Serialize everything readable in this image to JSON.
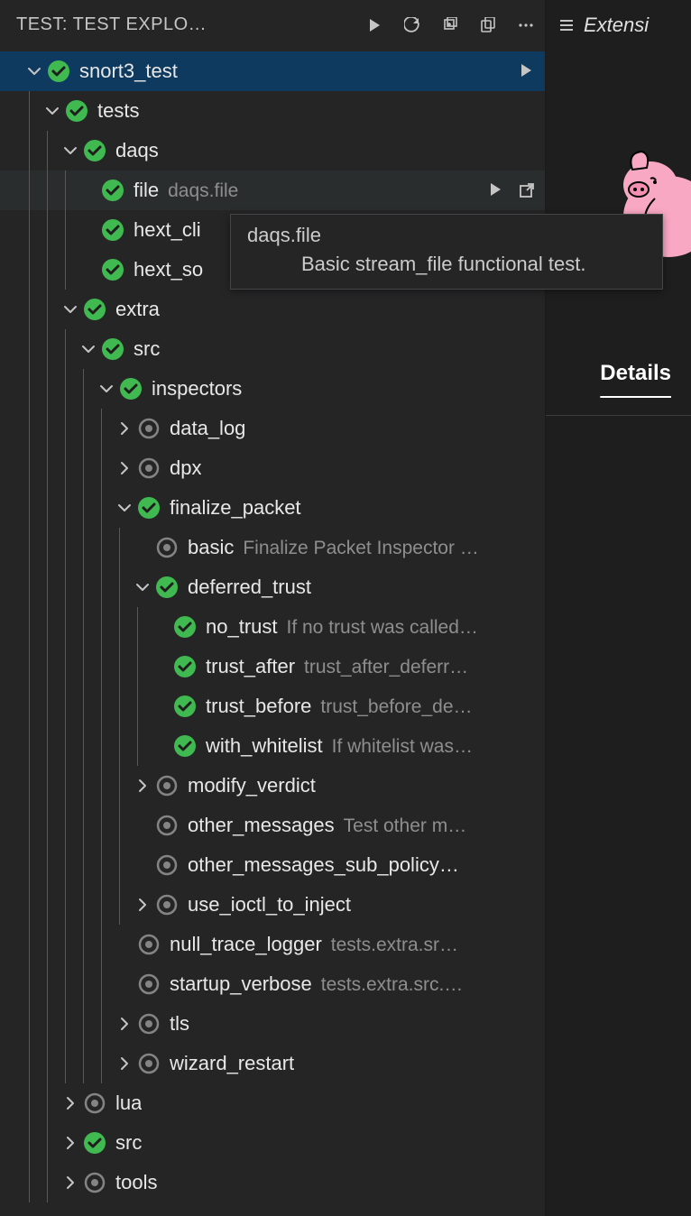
{
  "tabTitle": "TEST: TEST EXPLO…",
  "extTab": "Extensi",
  "detailsTab": "Details",
  "tooltip": {
    "title": "daqs.file",
    "body": "Basic stream_file functional test."
  },
  "tree": [
    {
      "depth": 0,
      "chev": "down",
      "status": "pass",
      "label": "snort3_test",
      "selected": true,
      "actions": [
        "play"
      ]
    },
    {
      "depth": 1,
      "chev": "down",
      "status": "pass",
      "label": "tests"
    },
    {
      "depth": 2,
      "chev": "down",
      "status": "pass",
      "label": "daqs"
    },
    {
      "depth": 3,
      "chev": "none",
      "status": "pass",
      "label": "file",
      "desc": "daqs.file",
      "hovered": true,
      "actions": [
        "play",
        "go"
      ]
    },
    {
      "depth": 3,
      "chev": "none",
      "status": "pass",
      "label": "hext_cli"
    },
    {
      "depth": 3,
      "chev": "none",
      "status": "pass",
      "label": "hext_so"
    },
    {
      "depth": 2,
      "chev": "down",
      "status": "pass",
      "label": "extra"
    },
    {
      "depth": 3,
      "chev": "down",
      "status": "pass",
      "label": "src"
    },
    {
      "depth": 4,
      "chev": "down",
      "status": "pass",
      "label": "inspectors"
    },
    {
      "depth": 5,
      "chev": "right",
      "status": "notrun",
      "label": "data_log"
    },
    {
      "depth": 5,
      "chev": "right",
      "status": "notrun",
      "label": "dpx"
    },
    {
      "depth": 5,
      "chev": "down",
      "status": "pass",
      "label": "finalize_packet"
    },
    {
      "depth": 6,
      "chev": "none",
      "status": "notrun",
      "label": "basic",
      "desc": "Finalize Packet Inspector …"
    },
    {
      "depth": 6,
      "chev": "down",
      "status": "pass",
      "label": "deferred_trust"
    },
    {
      "depth": 7,
      "chev": "none",
      "status": "pass",
      "label": "no_trust",
      "desc": "If no trust was called…"
    },
    {
      "depth": 7,
      "chev": "none",
      "status": "pass",
      "label": "trust_after",
      "desc": "trust_after_deferr…"
    },
    {
      "depth": 7,
      "chev": "none",
      "status": "pass",
      "label": "trust_before",
      "desc": "trust_before_de…"
    },
    {
      "depth": 7,
      "chev": "none",
      "status": "pass",
      "label": "with_whitelist",
      "desc": "If whitelist was…"
    },
    {
      "depth": 6,
      "chev": "right",
      "status": "notrun",
      "label": "modify_verdict"
    },
    {
      "depth": 6,
      "chev": "none",
      "status": "notrun",
      "label": "other_messages",
      "desc": "Test other m…"
    },
    {
      "depth": 6,
      "chev": "none",
      "status": "notrun",
      "label": "other_messages_sub_policy…"
    },
    {
      "depth": 6,
      "chev": "right",
      "status": "notrun",
      "label": "use_ioctl_to_inject"
    },
    {
      "depth": 5,
      "chev": "none",
      "status": "notrun",
      "label": "null_trace_logger",
      "desc": "tests.extra.sr…"
    },
    {
      "depth": 5,
      "chev": "none",
      "status": "notrun",
      "label": "startup_verbose",
      "desc": "tests.extra.src.…"
    },
    {
      "depth": 5,
      "chev": "right",
      "status": "notrun",
      "label": "tls"
    },
    {
      "depth": 5,
      "chev": "right",
      "status": "notrun",
      "label": "wizard_restart"
    },
    {
      "depth": 2,
      "chev": "right",
      "status": "notrun",
      "label": "lua"
    },
    {
      "depth": 2,
      "chev": "right",
      "status": "pass",
      "label": "src"
    },
    {
      "depth": 2,
      "chev": "right",
      "status": "notrun",
      "label": "tools"
    }
  ]
}
